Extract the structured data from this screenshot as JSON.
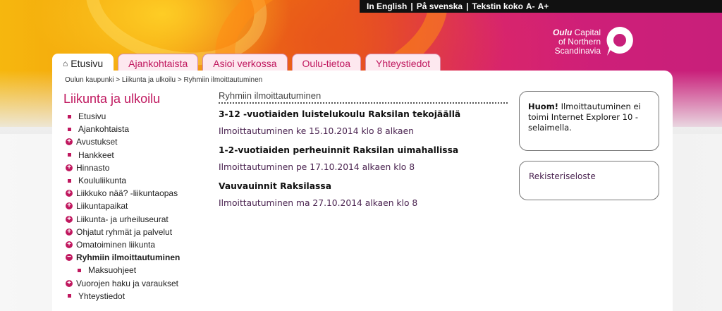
{
  "topbar": {
    "english": "In English",
    "swedish": "På svenska",
    "text_size_label": "Tekstin koko",
    "text_size_down": "A-",
    "text_size_up": "A+"
  },
  "logo": {
    "line1_bold": "Oulu",
    "line1_rest": "Capital",
    "line2": "of Northern",
    "line3": "Scandinavia"
  },
  "tabs": [
    {
      "label": "Etusivu",
      "active": true
    },
    {
      "label": "Ajankohtaista"
    },
    {
      "label": "Asioi verkossa"
    },
    {
      "label": "Oulu-tietoa"
    },
    {
      "label": "Yhteystiedot"
    }
  ],
  "breadcrumb": [
    "Oulun kaupunki",
    "Liikunta ja ulkoilu",
    "Ryhmiin ilmoittautuminen"
  ],
  "sidebar": {
    "title": "Liikunta ja ulkoilu",
    "items": [
      {
        "label": "Etusivu",
        "marker": "square"
      },
      {
        "label": "Ajankohtaista",
        "marker": "square"
      },
      {
        "label": "Avustukset",
        "marker": "plus"
      },
      {
        "label": "Hankkeet",
        "marker": "square"
      },
      {
        "label": "Hinnasto",
        "marker": "plus"
      },
      {
        "label": "Koululiikunta",
        "marker": "square"
      },
      {
        "label": "Liikkuko nää? -liikuntaopas",
        "marker": "plus"
      },
      {
        "label": "Liikuntapaikat",
        "marker": "plus"
      },
      {
        "label": "Liikunta- ja urheiluseurat",
        "marker": "plus"
      },
      {
        "label": "Ohjatut ryhmät ja palvelut",
        "marker": "plus"
      },
      {
        "label": "Omatoiminen liikunta",
        "marker": "plus"
      },
      {
        "label": "Ryhmiin ilmoittautuminen",
        "marker": "minus",
        "active": true
      },
      {
        "label": "Maksuohjeet",
        "marker": "square",
        "sub": true
      },
      {
        "label": "Vuorojen haku ja varaukset",
        "marker": "plus"
      },
      {
        "label": "Yhteystiedot",
        "marker": "square"
      }
    ]
  },
  "main": {
    "title": "Ryhmiin ilmoittautuminen",
    "events": [
      {
        "title": "3-12 -vuotiaiden luistelukoulu Raksilan tekojäällä",
        "date": "Ilmoittautuminen ke 15.10.2014 klo 8 alkaen"
      },
      {
        "title": "1-2-vuotiaiden perheuinnit Raksilan uimahallissa",
        "date": "Ilmoittautuminen pe 17.10.2014 alkaen klo 8"
      },
      {
        "title": "Vauvauinnit Raksilassa",
        "date": "Ilmoittautuminen ma 27.10.2014 alkaen klo 8"
      }
    ]
  },
  "notice": {
    "bold": "Huom!",
    "text": " Ilmoittautuminen ei toimi Internet Explorer 10 -selaimella."
  },
  "register_link": "Rekisteriseloste",
  "colors": {
    "accent": "#c0185f",
    "link": "#4a2350",
    "tab_bg": "#fde8ef"
  }
}
